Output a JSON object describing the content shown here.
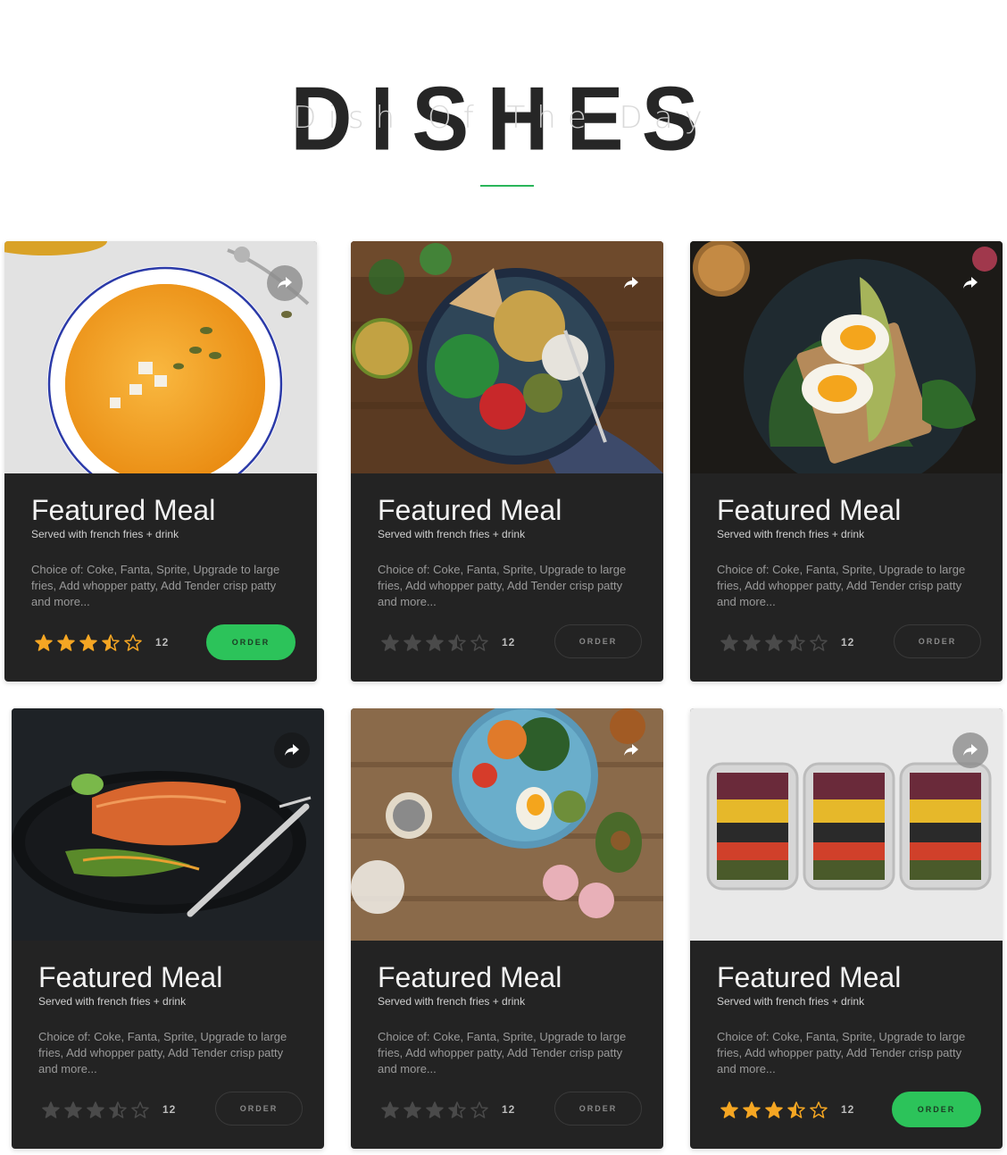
{
  "hero": {
    "title": "DISHES",
    "subtitle": "Dish Of The Day",
    "accent_color": "#2ab55a"
  },
  "cards": [
    {
      "title": "Featured Meal",
      "subtitle": "Served with french fries + drink",
      "description": "Choice of: Coke, Fanta, Sprite, Upgrade to large fries, Add whopper patty, Add Tender crisp patty and more...",
      "rating": 3.5,
      "rating_count": "12",
      "order_label": "ORDER",
      "order_active": true,
      "image": "pumpkin-soup"
    },
    {
      "title": "Featured Meal",
      "subtitle": "Served with french fries + drink",
      "description": "Choice of: Coke, Fanta, Sprite, Upgrade to large fries, Add whopper patty, Add Tender crisp patty and more...",
      "rating": 3.5,
      "rating_count": "12",
      "order_label": "ORDER",
      "order_active": false,
      "image": "chickpea-bowl"
    },
    {
      "title": "Featured Meal",
      "subtitle": "Served with french fries + drink",
      "description": "Choice of: Coke, Fanta, Sprite, Upgrade to large fries, Add whopper patty, Add Tender crisp patty and more...",
      "rating": 3.5,
      "rating_count": "12",
      "order_label": "ORDER",
      "order_active": false,
      "image": "egg-avocado-toast"
    },
    {
      "title": "Featured Meal",
      "subtitle": "Served with french fries + drink",
      "description": "Choice of: Coke, Fanta, Sprite, Upgrade to large fries, Add whopper patty, Add Tender crisp patty and more...",
      "rating": 3.5,
      "rating_count": "12",
      "order_label": "ORDER",
      "order_active": false,
      "image": "salmon-plate"
    },
    {
      "title": "Featured Meal",
      "subtitle": "Served with french fries + drink",
      "description": "Choice of: Coke, Fanta, Sprite, Upgrade to large fries, Add whopper patty, Add Tender crisp patty and more...",
      "rating": 3.5,
      "rating_count": "12",
      "order_label": "ORDER",
      "order_active": false,
      "image": "salad-plate"
    },
    {
      "title": "Featured Meal",
      "subtitle": "Served with french fries + drink",
      "description": "Choice of: Coke, Fanta, Sprite, Upgrade to large fries, Add whopper patty, Add Tender crisp patty and more...",
      "rating": 3.5,
      "rating_count": "12",
      "order_label": "ORDER",
      "order_active": true,
      "image": "meal-prep-boxes"
    }
  ],
  "colors": {
    "card_bg": "#232323",
    "star_active": "#f5a623",
    "star_inactive": "#4a4a4a",
    "order_active_bg": "#2cc35a"
  }
}
